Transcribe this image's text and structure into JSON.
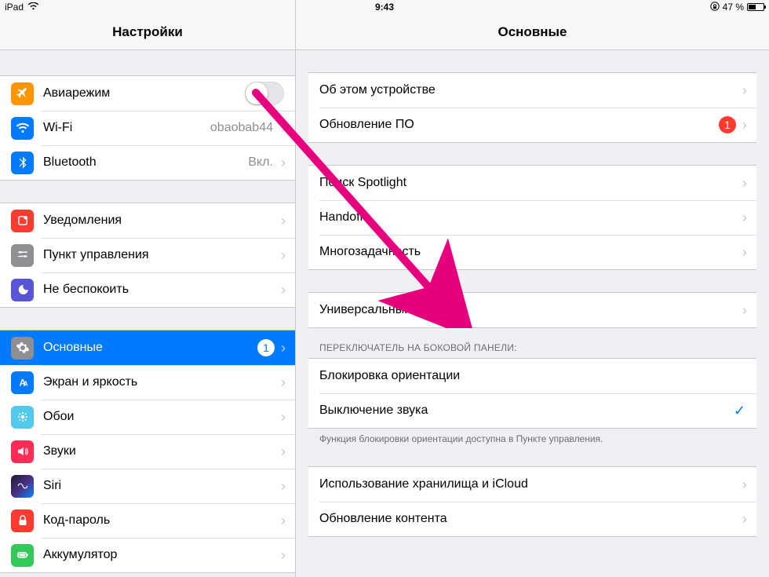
{
  "status": {
    "carrier": "iPad",
    "time": "9:43",
    "battery_pct": "47 %"
  },
  "sidebar": {
    "title": "Настройки",
    "g1": {
      "airplane": "Авиарежим",
      "wifi": "Wi-Fi",
      "wifi_val": "obaobab44",
      "bt": "Bluetooth",
      "bt_val": "Вкл."
    },
    "g2": {
      "notif": "Уведомления",
      "cc": "Пункт управления",
      "dnd": "Не беспокоить"
    },
    "g3": {
      "general": "Основные",
      "general_badge": "1",
      "display": "Экран и яркость",
      "wall": "Обои",
      "sound": "Звуки",
      "siri": "Siri",
      "pass": "Код-пароль",
      "batt": "Аккумулятор"
    }
  },
  "detail": {
    "title": "Основные",
    "about": "Об этом устройстве",
    "update": "Обновление ПО",
    "update_badge": "1",
    "spotlight": "Поиск Spotlight",
    "handoff": "Handoff",
    "multitask": "Многозадачность",
    "accessibility": "Универсальный доступ",
    "switch_header": "ПЕРЕКЛЮЧАТЕЛЬ НА БОКОВОЙ ПАНЕЛИ:",
    "lock_rot": "Блокировка ориентации",
    "mute": "Выключение звука",
    "switch_footer": "Функция блокировки ориентации доступна в Пункте управления.",
    "storage": "Использование хранилища и iCloud",
    "bgrefresh": "Обновление контента"
  }
}
